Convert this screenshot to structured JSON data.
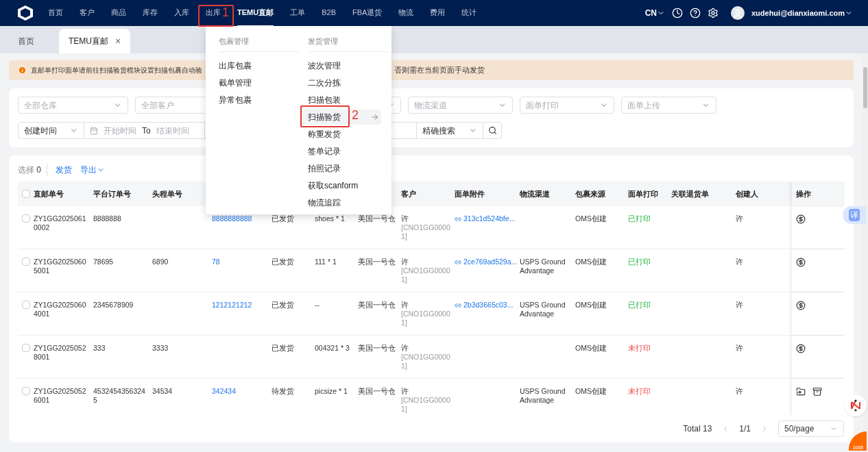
{
  "nav": {
    "items": [
      {
        "label": "首页",
        "selected": false
      },
      {
        "label": "客户",
        "selected": false
      },
      {
        "label": "商品",
        "selected": false
      },
      {
        "label": "库存",
        "selected": false
      },
      {
        "label": "入库",
        "selected": false
      },
      {
        "label": "出库",
        "selected": false,
        "callout": "1"
      },
      {
        "label": "TEMU直邮",
        "selected": true
      },
      {
        "label": "工单",
        "selected": false
      },
      {
        "label": "B2B",
        "selected": false
      },
      {
        "label": "FBA退货",
        "selected": false
      },
      {
        "label": "物流",
        "selected": false
      },
      {
        "label": "费用",
        "selected": false
      },
      {
        "label": "统计",
        "selected": false
      }
    ],
    "language": "CN",
    "user": "xudehui@dianxiaomi.com"
  },
  "tabs": [
    {
      "label": "首页",
      "selected": false
    },
    {
      "label": "TEMU直邮",
      "selected": true,
      "close": "×"
    }
  ],
  "alert": {
    "text_before": "直邮单打印面单请前往扫描验货模块设置扫描包裹自动验",
    "text_after": "否则需在当前页面手动发货"
  },
  "filters": {
    "row1": [
      {
        "kind": "select",
        "placeholder": "全部仓库"
      },
      {
        "kind": "select",
        "placeholder": "全部客户"
      },
      {
        "kind": "select"
      },
      {
        "kind": "select",
        "placeholder": "物流渠道"
      },
      {
        "kind": "select",
        "placeholder": "面单打印"
      },
      {
        "kind": "select",
        "placeholder": "面单上传"
      }
    ],
    "date_type": "创建时间",
    "start_placeholder": "开始时间",
    "to": "To",
    "end_placeholder": "结束时间",
    "search_mode": "精确搜索"
  },
  "toolbar": {
    "selected_label": "选择",
    "selected_count": "0",
    "ship": "发货",
    "export": "导出"
  },
  "table": {
    "header_checked": false,
    "columns": [
      "直邮单号",
      "平台订单号",
      "头程单号",
      "",
      "",
      "",
      "",
      "客户",
      "面单附件",
      "物流渠道",
      "包裹来源",
      "面单打印",
      "关联退货单",
      "创建人",
      "操作"
    ],
    "rows": [
      {
        "checked": false,
        "cells": [
          "ZY1GG20250610002",
          "8888888",
          "",
          "8888888888",
          "已发货",
          "shoes * 1",
          "美国一号仓"
        ],
        "customer": "许",
        "customer_code": "[CNO1GG00001]",
        "attachment": "313c1d524bfe...",
        "channel": "",
        "source": "OMS创建",
        "print": "已打印",
        "printed": true,
        "creator": "许",
        "actions": [
          {
            "kind": "money"
          }
        ]
      },
      {
        "checked": false,
        "cells": [
          "ZY1GG20250605001",
          "78695",
          "6890",
          "78",
          "已发货",
          "111 * 1",
          "美国一号仓"
        ],
        "customer": "许",
        "customer_code": "[CNO1GG00001]",
        "attachment": "2ce769ad529a...",
        "channel": "USPS Ground Advantage",
        "source": "OMS创建",
        "print": "已打印",
        "printed": true,
        "creator": "许",
        "actions": [
          {
            "kind": "money"
          }
        ]
      },
      {
        "checked": false,
        "cells": [
          "ZY1GG20250604001",
          "2345678909",
          "",
          "1212121212",
          "已发货",
          "--",
          "美国一号仓"
        ],
        "customer": "许",
        "customer_code": "[CNO1GG00001]",
        "attachment": "2b3d3665c03...",
        "channel": "USPS Ground Advantage",
        "source": "OMS创建",
        "print": "已打印",
        "printed": true,
        "creator": "许",
        "actions": [
          {
            "kind": "money"
          }
        ]
      },
      {
        "checked": false,
        "cells": [
          "ZY1GG20250528001",
          "333",
          "3333",
          "",
          "已发货",
          "004321 * 3",
          "美国一号仓"
        ],
        "customer": "许",
        "customer_code": "[CNO1GG00001]",
        "channel": "",
        "source": "OMS创建",
        "print": "未打印",
        "printed": false,
        "creator": "许",
        "actions": [
          {
            "kind": "money"
          }
        ]
      },
      {
        "checked": false,
        "cells": [
          "ZY1GG20250526001",
          "45324543563245",
          "34534",
          "342434",
          "待发货",
          "picsize * 1",
          "美国一号仓"
        ],
        "customer": "许",
        "customer_code": "[CNO1GG00001]",
        "channel": "USPS Ground Advantage",
        "source": "OMS创建",
        "print": "未打印",
        "printed": false,
        "creator": "许",
        "actions": [
          {
            "kind": "export"
          },
          {
            "kind": "archive"
          }
        ]
      }
    ]
  },
  "pagination": {
    "total": "Total 13",
    "page": "1/1",
    "page_size": "50/page"
  },
  "menu": {
    "groups": [
      {
        "title": "包裹管理",
        "items": [
          {
            "label": "出库包裹",
            "selected": false
          },
          {
            "label": "截单管理",
            "selected": false
          },
          {
            "label": "异常包裹",
            "selected": false
          }
        ]
      },
      {
        "title": "发货管理",
        "items": [
          {
            "label": "波次管理",
            "selected": false
          },
          {
            "label": "二次分拣",
            "selected": false
          },
          {
            "label": "扫描包装",
            "selected": false
          },
          {
            "label": "扫描验货",
            "selected": true,
            "callout": "2"
          },
          {
            "label": "称重发货",
            "selected": false
          },
          {
            "label": "签单记录",
            "selected": false
          },
          {
            "label": "拍照记录",
            "selected": false
          },
          {
            "label": "获取scanform",
            "selected": false
          },
          {
            "label": "物流追踪",
            "selected": false
          }
        ]
      }
    ]
  },
  "floating": {
    "translate": "译",
    "badge": "1688"
  }
}
